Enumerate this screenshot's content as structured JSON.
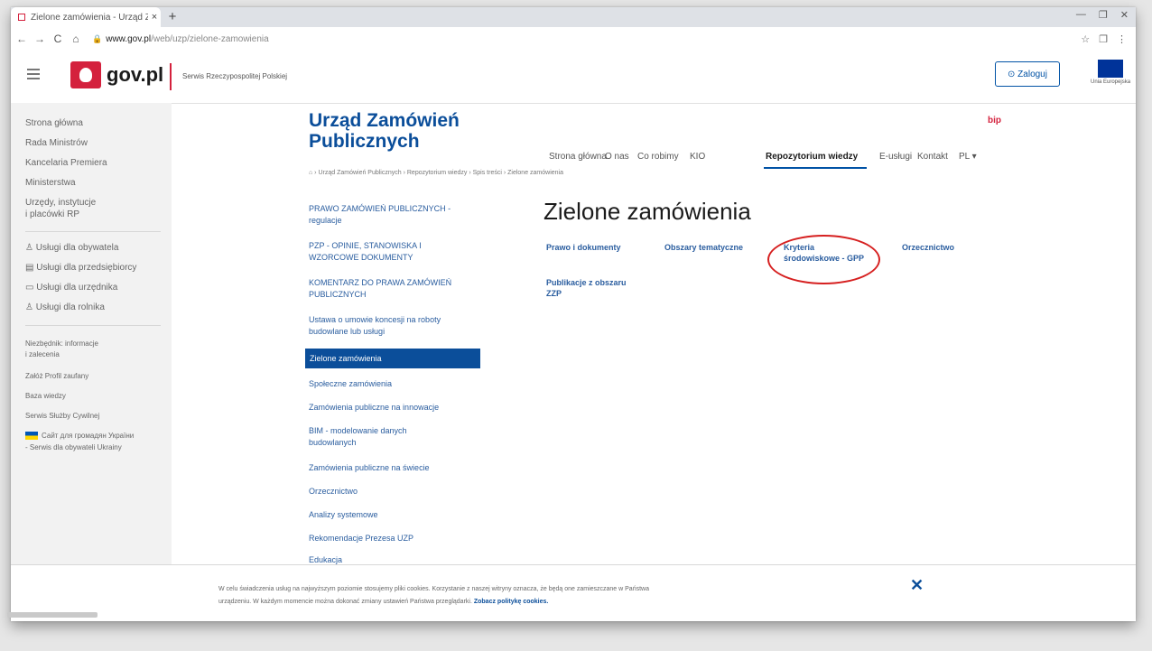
{
  "browser": {
    "tab_title": "Zielone zamówienia - Urząd Za...",
    "tab_close": "×",
    "new_tab": "+",
    "url_host": "www.gov.pl",
    "url_path": "/web/uzp/zielone-zamowienia",
    "nav_back": "←",
    "nav_forward": "→",
    "nav_reload": "C",
    "nav_home": "⌂",
    "win_min": "—",
    "win_max": "❐",
    "win_close": "✕",
    "ext_1": "☆",
    "ext_2": "❐",
    "ext_3": "⋮"
  },
  "header": {
    "logo_text": "gov.pl",
    "service_name": "Serwis Rzeczypospolitej Polskiej",
    "login_label": "Zaloguj",
    "eu_caption": "Unia Europejska"
  },
  "left_sidebar": {
    "items": [
      "Strona główna",
      "Rada Ministrów",
      "Kancelaria Premiera",
      "Ministerstwa",
      "Urzędy, instytucje",
      "i placówki RP",
      "Usługi dla obywatela",
      "Usługi dla przedsiębiorcy",
      "Usługi dla urzędnika",
      "Usługi dla rolnika",
      "Niezbędnik: informacje",
      "i zalecenia",
      "Załóż Profil zaufany",
      "Baza wiedzy",
      "Serwis Służby Cywilnej",
      "Сайт для громадян України",
      "- Serwis dla obywateli Ukrainy"
    ]
  },
  "org": {
    "title_line1": "Urząd Zamówień",
    "title_line2": "Publicznych",
    "bip": "bip"
  },
  "topnav": {
    "items": [
      "Strona główna",
      "O nas",
      "Co robimy",
      "KIO",
      "Repozytorium wiedzy",
      "E-usługi",
      "Kontakt",
      "PL ▾"
    ],
    "active_index": 4
  },
  "breadcrumb": "⌂  ›  Urząd Zamówień Publicznych  ›  Repozytorium wiedzy  ›  Spis treści  ›  Zielone zamówienia",
  "sidenav": {
    "items": [
      "PRAWO ZAMÓWIEŃ PUBLICZNYCH -",
      "regulacje",
      "PZP - OPINIE, STANOWISKA I",
      "WZORCOWE DOKUMENTY",
      "KOMENTARZ DO PRAWA ZAMÓWIEŃ",
      "PUBLICZNYCH",
      "Ustawa o umowie koncesji na roboty",
      "budowlane lub usługi",
      "Zielone zamówienia",
      "Społeczne zamówienia",
      "Zamówienia publiczne na innowacje",
      "BIM - modelowanie danych",
      "budowlanych",
      "Zamówienia publiczne na świecie",
      "Orzecznictwo",
      "Analizy systemowe",
      "Rekomendacje Prezesa UZP",
      "Edukacja"
    ]
  },
  "main": {
    "title": "Zielone zamówienia",
    "links": [
      "Prawo i dokumenty",
      "Obszary tematyczne",
      "Kryteria",
      "środowiskowe - GPP",
      "Orzecznictwo",
      "Publikacje z obszaru",
      "ZZP"
    ]
  },
  "cookie": {
    "line1": "W celu świadczenia usług na najwyższym poziomie stosujemy pliki cookies. Korzystanie z naszej witryny oznacza, że będą one zamieszczane w Państwa",
    "line2": "urządzeniu. W każdym momencie można dokonać zmiany ustawień Państwa przeglądarki.",
    "link": "Zobacz politykę cookies.",
    "close": "✕"
  },
  "colors": {
    "brand_blue": "#0b4e9a",
    "link_blue": "#2a5d9f",
    "gov_red": "#d4213d",
    "highlight_red": "#d62020"
  }
}
